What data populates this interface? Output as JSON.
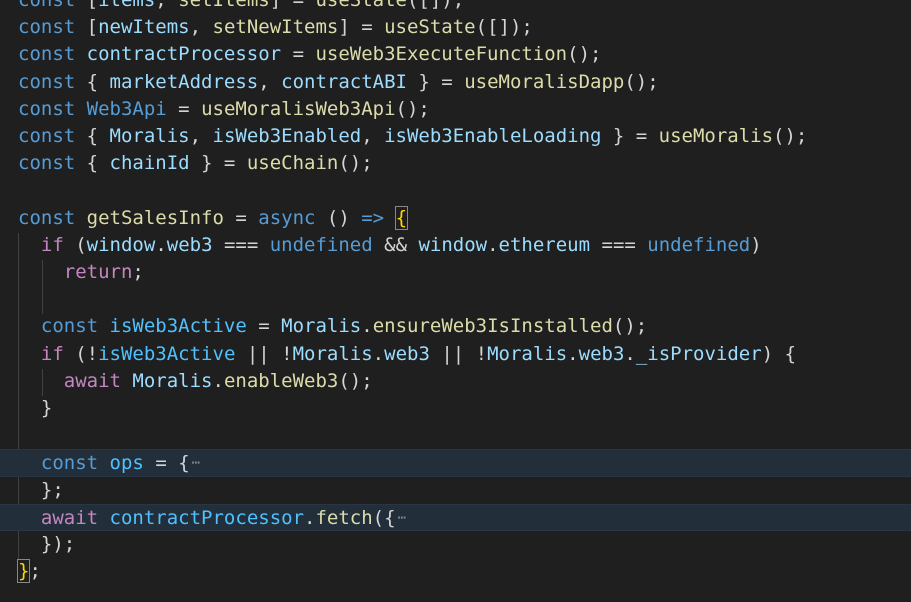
{
  "editor": {
    "lines": [
      {
        "tokens": [
          [
            "kw",
            "const"
          ],
          [
            "pun",
            " ["
          ],
          [
            "var",
            "items"
          ],
          [
            "pun",
            ", "
          ],
          [
            "fn",
            "setItems"
          ],
          [
            "pun",
            "] = "
          ],
          [
            "fn",
            "useState"
          ],
          [
            "pun",
            "([]);"
          ]
        ]
      },
      {
        "tokens": [
          [
            "kw",
            "const"
          ],
          [
            "pun",
            " ["
          ],
          [
            "var",
            "newItems"
          ],
          [
            "pun",
            ", "
          ],
          [
            "fn",
            "setNewItems"
          ],
          [
            "pun",
            "] = "
          ],
          [
            "fn",
            "useState"
          ],
          [
            "pun",
            "([]);"
          ]
        ]
      },
      {
        "tokens": [
          [
            "kw",
            "const"
          ],
          [
            "pun",
            " "
          ],
          [
            "var",
            "contractProcessor"
          ],
          [
            "pun",
            " = "
          ],
          [
            "fn",
            "useWeb3ExecuteFunction"
          ],
          [
            "pun",
            "();"
          ]
        ]
      },
      {
        "tokens": [
          [
            "kw",
            "const"
          ],
          [
            "pun",
            " { "
          ],
          [
            "var",
            "marketAddress"
          ],
          [
            "pun",
            ", "
          ],
          [
            "var",
            "contractABI"
          ],
          [
            "pun",
            " } = "
          ],
          [
            "fn",
            "useMoralisDapp"
          ],
          [
            "pun",
            "();"
          ]
        ]
      },
      {
        "tokens": [
          [
            "kw",
            "const"
          ],
          [
            "pun",
            " "
          ],
          [
            "kw",
            "Web3Api"
          ],
          [
            "pun",
            " = "
          ],
          [
            "fn",
            "useMoralisWeb3Api"
          ],
          [
            "pun",
            "();"
          ]
        ]
      },
      {
        "tokens": [
          [
            "kw",
            "const"
          ],
          [
            "pun",
            " { "
          ],
          [
            "var",
            "Moralis"
          ],
          [
            "pun",
            ", "
          ],
          [
            "var",
            "isWeb3Enabled"
          ],
          [
            "pun",
            ", "
          ],
          [
            "var",
            "isWeb3EnableLoading"
          ],
          [
            "pun",
            " } = "
          ],
          [
            "fn",
            "useMoralis"
          ],
          [
            "pun",
            "();"
          ]
        ]
      },
      {
        "tokens": [
          [
            "kw",
            "const"
          ],
          [
            "pun",
            " { "
          ],
          [
            "var",
            "chainId"
          ],
          [
            "pun",
            " } = "
          ],
          [
            "fn",
            "useChain"
          ],
          [
            "pun",
            "();"
          ]
        ]
      },
      {
        "tokens": []
      },
      {
        "tokens": [
          [
            "kw",
            "const"
          ],
          [
            "pun",
            " "
          ],
          [
            "fn",
            "getSalesInfo"
          ],
          [
            "pun",
            " = "
          ],
          [
            "kw",
            "async"
          ],
          [
            "pun",
            " () "
          ],
          [
            "kw",
            "=>"
          ],
          [
            "pun",
            " "
          ],
          [
            "match",
            "{"
          ]
        ]
      },
      {
        "tokens": [
          [
            "pun",
            "  "
          ],
          [
            "ctl",
            "if"
          ],
          [
            "pun",
            " ("
          ],
          [
            "var",
            "window"
          ],
          [
            "pun",
            "."
          ],
          [
            "var",
            "web3"
          ],
          [
            "pun",
            " === "
          ],
          [
            "kw",
            "undefined"
          ],
          [
            "pun",
            " && "
          ],
          [
            "var",
            "window"
          ],
          [
            "pun",
            "."
          ],
          [
            "var",
            "ethereum"
          ],
          [
            "pun",
            " === "
          ],
          [
            "kw",
            "undefined"
          ],
          [
            "pun",
            ")"
          ]
        ]
      },
      {
        "tokens": [
          [
            "pun",
            "    "
          ],
          [
            "ctl",
            "return"
          ],
          [
            "pun",
            ";"
          ]
        ]
      },
      {
        "tokens": []
      },
      {
        "tokens": [
          [
            "pun",
            "  "
          ],
          [
            "kw",
            "const"
          ],
          [
            "pun",
            " "
          ],
          [
            "cst",
            "isWeb3Active"
          ],
          [
            "pun",
            " = "
          ],
          [
            "var",
            "Moralis"
          ],
          [
            "pun",
            "."
          ],
          [
            "fn",
            "ensureWeb3IsInstalled"
          ],
          [
            "pun",
            "();"
          ]
        ]
      },
      {
        "tokens": [
          [
            "pun",
            "  "
          ],
          [
            "ctl",
            "if"
          ],
          [
            "pun",
            " (!"
          ],
          [
            "cst",
            "isWeb3Active"
          ],
          [
            "pun",
            " || !"
          ],
          [
            "var",
            "Moralis"
          ],
          [
            "pun",
            "."
          ],
          [
            "var",
            "web3"
          ],
          [
            "pun",
            " || !"
          ],
          [
            "var",
            "Moralis"
          ],
          [
            "pun",
            "."
          ],
          [
            "var",
            "web3"
          ],
          [
            "pun",
            "."
          ],
          [
            "var",
            "_isProvider"
          ],
          [
            "pun",
            ") {"
          ]
        ]
      },
      {
        "tokens": [
          [
            "pun",
            "    "
          ],
          [
            "ctl",
            "await"
          ],
          [
            "pun",
            " "
          ],
          [
            "var",
            "Moralis"
          ],
          [
            "pun",
            "."
          ],
          [
            "fn",
            "enableWeb3"
          ],
          [
            "pun",
            "();"
          ]
        ]
      },
      {
        "tokens": [
          [
            "pun",
            "  }"
          ]
        ]
      },
      {
        "tokens": []
      },
      {
        "highlight": true,
        "tokens": [
          [
            "pun",
            "  "
          ],
          [
            "kw",
            "const"
          ],
          [
            "pun",
            " "
          ],
          [
            "cst",
            "ops"
          ],
          [
            "pun",
            " = {"
          ],
          [
            "fold",
            "⋯"
          ]
        ]
      },
      {
        "tokens": [
          [
            "pun",
            "  };"
          ]
        ]
      },
      {
        "highlight": true,
        "tokens": [
          [
            "pun",
            "  "
          ],
          [
            "ctl",
            "await"
          ],
          [
            "pun",
            " "
          ],
          [
            "cst",
            "contractProcessor"
          ],
          [
            "pun",
            "."
          ],
          [
            "fn",
            "fetch"
          ],
          [
            "pun",
            "({"
          ],
          [
            "fold",
            "⋯"
          ]
        ]
      },
      {
        "tokens": [
          [
            "pun",
            "  });"
          ]
        ]
      },
      {
        "tokens": [
          [
            "match",
            "}"
          ],
          [
            "pun",
            ";"
          ]
        ]
      }
    ]
  }
}
